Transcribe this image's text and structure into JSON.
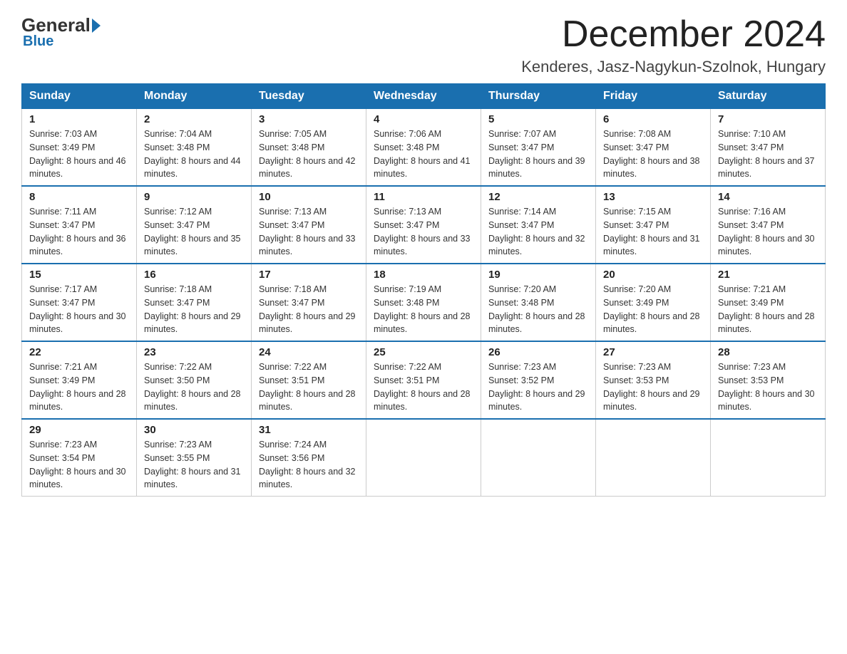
{
  "header": {
    "logo_general": "General",
    "logo_blue": "Blue",
    "month_title": "December 2024",
    "location": "Kenderes, Jasz-Nagykun-Szolnok, Hungary"
  },
  "days_of_week": [
    "Sunday",
    "Monday",
    "Tuesday",
    "Wednesday",
    "Thursday",
    "Friday",
    "Saturday"
  ],
  "weeks": [
    [
      {
        "day": 1,
        "sunrise": "7:03 AM",
        "sunset": "3:49 PM",
        "daylight": "8 hours and 46 minutes"
      },
      {
        "day": 2,
        "sunrise": "7:04 AM",
        "sunset": "3:48 PM",
        "daylight": "8 hours and 44 minutes"
      },
      {
        "day": 3,
        "sunrise": "7:05 AM",
        "sunset": "3:48 PM",
        "daylight": "8 hours and 42 minutes"
      },
      {
        "day": 4,
        "sunrise": "7:06 AM",
        "sunset": "3:48 PM",
        "daylight": "8 hours and 41 minutes"
      },
      {
        "day": 5,
        "sunrise": "7:07 AM",
        "sunset": "3:47 PM",
        "daylight": "8 hours and 39 minutes"
      },
      {
        "day": 6,
        "sunrise": "7:08 AM",
        "sunset": "3:47 PM",
        "daylight": "8 hours and 38 minutes"
      },
      {
        "day": 7,
        "sunrise": "7:10 AM",
        "sunset": "3:47 PM",
        "daylight": "8 hours and 37 minutes"
      }
    ],
    [
      {
        "day": 8,
        "sunrise": "7:11 AM",
        "sunset": "3:47 PM",
        "daylight": "8 hours and 36 minutes"
      },
      {
        "day": 9,
        "sunrise": "7:12 AM",
        "sunset": "3:47 PM",
        "daylight": "8 hours and 35 minutes"
      },
      {
        "day": 10,
        "sunrise": "7:13 AM",
        "sunset": "3:47 PM",
        "daylight": "8 hours and 33 minutes"
      },
      {
        "day": 11,
        "sunrise": "7:13 AM",
        "sunset": "3:47 PM",
        "daylight": "8 hours and 33 minutes"
      },
      {
        "day": 12,
        "sunrise": "7:14 AM",
        "sunset": "3:47 PM",
        "daylight": "8 hours and 32 minutes"
      },
      {
        "day": 13,
        "sunrise": "7:15 AM",
        "sunset": "3:47 PM",
        "daylight": "8 hours and 31 minutes"
      },
      {
        "day": 14,
        "sunrise": "7:16 AM",
        "sunset": "3:47 PM",
        "daylight": "8 hours and 30 minutes"
      }
    ],
    [
      {
        "day": 15,
        "sunrise": "7:17 AM",
        "sunset": "3:47 PM",
        "daylight": "8 hours and 30 minutes"
      },
      {
        "day": 16,
        "sunrise": "7:18 AM",
        "sunset": "3:47 PM",
        "daylight": "8 hours and 29 minutes"
      },
      {
        "day": 17,
        "sunrise": "7:18 AM",
        "sunset": "3:47 PM",
        "daylight": "8 hours and 29 minutes"
      },
      {
        "day": 18,
        "sunrise": "7:19 AM",
        "sunset": "3:48 PM",
        "daylight": "8 hours and 28 minutes"
      },
      {
        "day": 19,
        "sunrise": "7:20 AM",
        "sunset": "3:48 PM",
        "daylight": "8 hours and 28 minutes"
      },
      {
        "day": 20,
        "sunrise": "7:20 AM",
        "sunset": "3:49 PM",
        "daylight": "8 hours and 28 minutes"
      },
      {
        "day": 21,
        "sunrise": "7:21 AM",
        "sunset": "3:49 PM",
        "daylight": "8 hours and 28 minutes"
      }
    ],
    [
      {
        "day": 22,
        "sunrise": "7:21 AM",
        "sunset": "3:49 PM",
        "daylight": "8 hours and 28 minutes"
      },
      {
        "day": 23,
        "sunrise": "7:22 AM",
        "sunset": "3:50 PM",
        "daylight": "8 hours and 28 minutes"
      },
      {
        "day": 24,
        "sunrise": "7:22 AM",
        "sunset": "3:51 PM",
        "daylight": "8 hours and 28 minutes"
      },
      {
        "day": 25,
        "sunrise": "7:22 AM",
        "sunset": "3:51 PM",
        "daylight": "8 hours and 28 minutes"
      },
      {
        "day": 26,
        "sunrise": "7:23 AM",
        "sunset": "3:52 PM",
        "daylight": "8 hours and 29 minutes"
      },
      {
        "day": 27,
        "sunrise": "7:23 AM",
        "sunset": "3:53 PM",
        "daylight": "8 hours and 29 minutes"
      },
      {
        "day": 28,
        "sunrise": "7:23 AM",
        "sunset": "3:53 PM",
        "daylight": "8 hours and 30 minutes"
      }
    ],
    [
      {
        "day": 29,
        "sunrise": "7:23 AM",
        "sunset": "3:54 PM",
        "daylight": "8 hours and 30 minutes"
      },
      {
        "day": 30,
        "sunrise": "7:23 AM",
        "sunset": "3:55 PM",
        "daylight": "8 hours and 31 minutes"
      },
      {
        "day": 31,
        "sunrise": "7:24 AM",
        "sunset": "3:56 PM",
        "daylight": "8 hours and 32 minutes"
      },
      null,
      null,
      null,
      null
    ]
  ]
}
